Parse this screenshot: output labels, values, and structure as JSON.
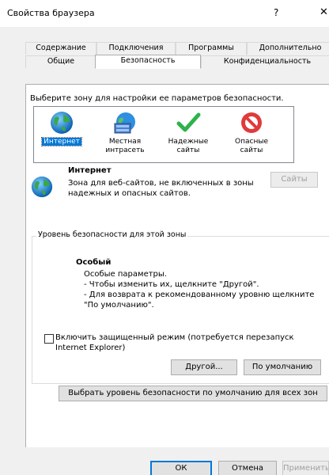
{
  "window": {
    "title": "Свойства браузера",
    "help_glyph": "?",
    "close_glyph": "✕"
  },
  "tabs_row1": [
    {
      "label": "Содержание"
    },
    {
      "label": "Подключения"
    },
    {
      "label": "Программы"
    },
    {
      "label": "Дополнительно"
    }
  ],
  "tabs_row2": [
    {
      "label": "Общие"
    },
    {
      "label": "Безопасность",
      "selected": true
    },
    {
      "label": "Конфиденциальность"
    }
  ],
  "security": {
    "zone_prompt": "Выберите зону для настройки ее параметров безопасности.",
    "zones": [
      {
        "label": "Интернет",
        "icon": "globe-icon",
        "selected": true
      },
      {
        "label": "Местная интрасеть",
        "icon": "intranet-icon"
      },
      {
        "label": "Надежные сайты",
        "icon": "checkmark-icon"
      },
      {
        "label": "Опасные сайты",
        "icon": "prohibited-icon"
      }
    ],
    "selected_zone": {
      "name": "Интернет",
      "description_line1": "Зона для веб-сайтов, не включенных в зоны",
      "description_line2": "надежных и опасных сайтов."
    },
    "sites_button": "Сайты",
    "level_group_title": "Уровень безопасности для этой зоны",
    "custom_level": {
      "title": "Особый",
      "line1": "Особые параметры.",
      "line2": "- Чтобы изменить их, щелкните \"Другой\".",
      "line3": "- Для возврата к рекомендованному уровню щелкните",
      "line4": "\"По умолчанию\"."
    },
    "protected_mode": {
      "line1": "Включить защищенный режим (потребуется перезапуск",
      "line2": "Internet Explorer)",
      "checked": false
    },
    "other_button": "Другой...",
    "default_button": "По умолчанию",
    "reset_all_button": "Выбрать уровень безопасности по умолчанию для всех зон"
  },
  "footer": {
    "ok": "ОК",
    "cancel": "Отмена",
    "apply": "Применить"
  },
  "colors": {
    "selection": "#0078d7",
    "dialog_bg": "#f0f0f0",
    "disabled_text": "#a0a0a0"
  }
}
